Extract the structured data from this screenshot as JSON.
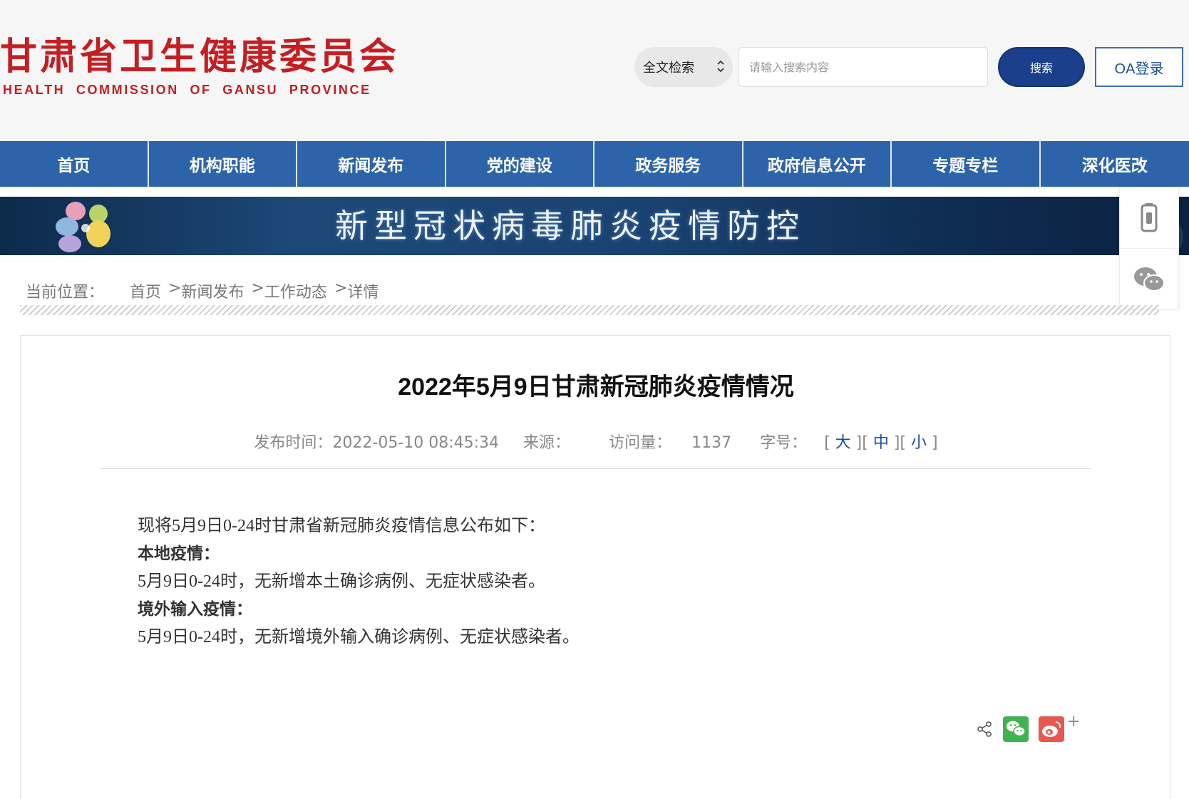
{
  "header": {
    "logo_cn": "甘肃省卫生健康委员会",
    "logo_en": "HEALTH COMMISSION OF GANSU PROVINCE",
    "brand_color": "#c41e22"
  },
  "search": {
    "scope_label": "全文检索",
    "placeholder": "请输入搜索内容",
    "value": "",
    "button_label": "搜索"
  },
  "oa_login_label": "OA登录",
  "nav": {
    "items": [
      {
        "label": "首页"
      },
      {
        "label": "机构职能"
      },
      {
        "label": "新闻发布"
      },
      {
        "label": "党的建设"
      },
      {
        "label": "政务服务"
      },
      {
        "label": "政府信息公开"
      },
      {
        "label": "专题专栏"
      },
      {
        "label": "深化医改"
      }
    ],
    "color": "#2d63a8"
  },
  "banner": {
    "text": "新型冠状病毒肺炎疫情防控"
  },
  "side_float": {
    "icons": [
      "mobile-icon",
      "wechat-icon"
    ]
  },
  "breadcrumb": {
    "label": "当前位置：",
    "items": [
      "首页",
      "新闻发布",
      "工作动态",
      "详情"
    ],
    "separator": ">"
  },
  "article": {
    "title": "2022年5月9日甘肃新冠肺炎疫情情况",
    "publish_label": "发布时间：",
    "publish_time": "2022-05-10 08:45:34",
    "source_label": "来源：",
    "source_value": "",
    "views_label": "访问量：",
    "views": "1137",
    "font_size_label": "字号：",
    "font_sizes": [
      "大",
      "中",
      "小"
    ],
    "paragraphs": [
      {
        "text": "现将5月9日0-24时甘肃省新冠肺炎疫情信息公布如下：",
        "bold": false
      },
      {
        "text": "本地疫情：",
        "bold": true
      },
      {
        "text": "5月9日0-24时，无新增本土确诊病例、无症状感染者。",
        "bold": false
      },
      {
        "text": "境外输入疫情：",
        "bold": true
      },
      {
        "text": "5月9日0-24时，无新增境外输入确诊病例、无症状感染者。",
        "bold": false
      }
    ]
  },
  "share": {
    "icons": [
      "share-icon",
      "wechat-share-icon",
      "weibo-share-icon",
      "plus-icon"
    ],
    "more_label": "+"
  }
}
